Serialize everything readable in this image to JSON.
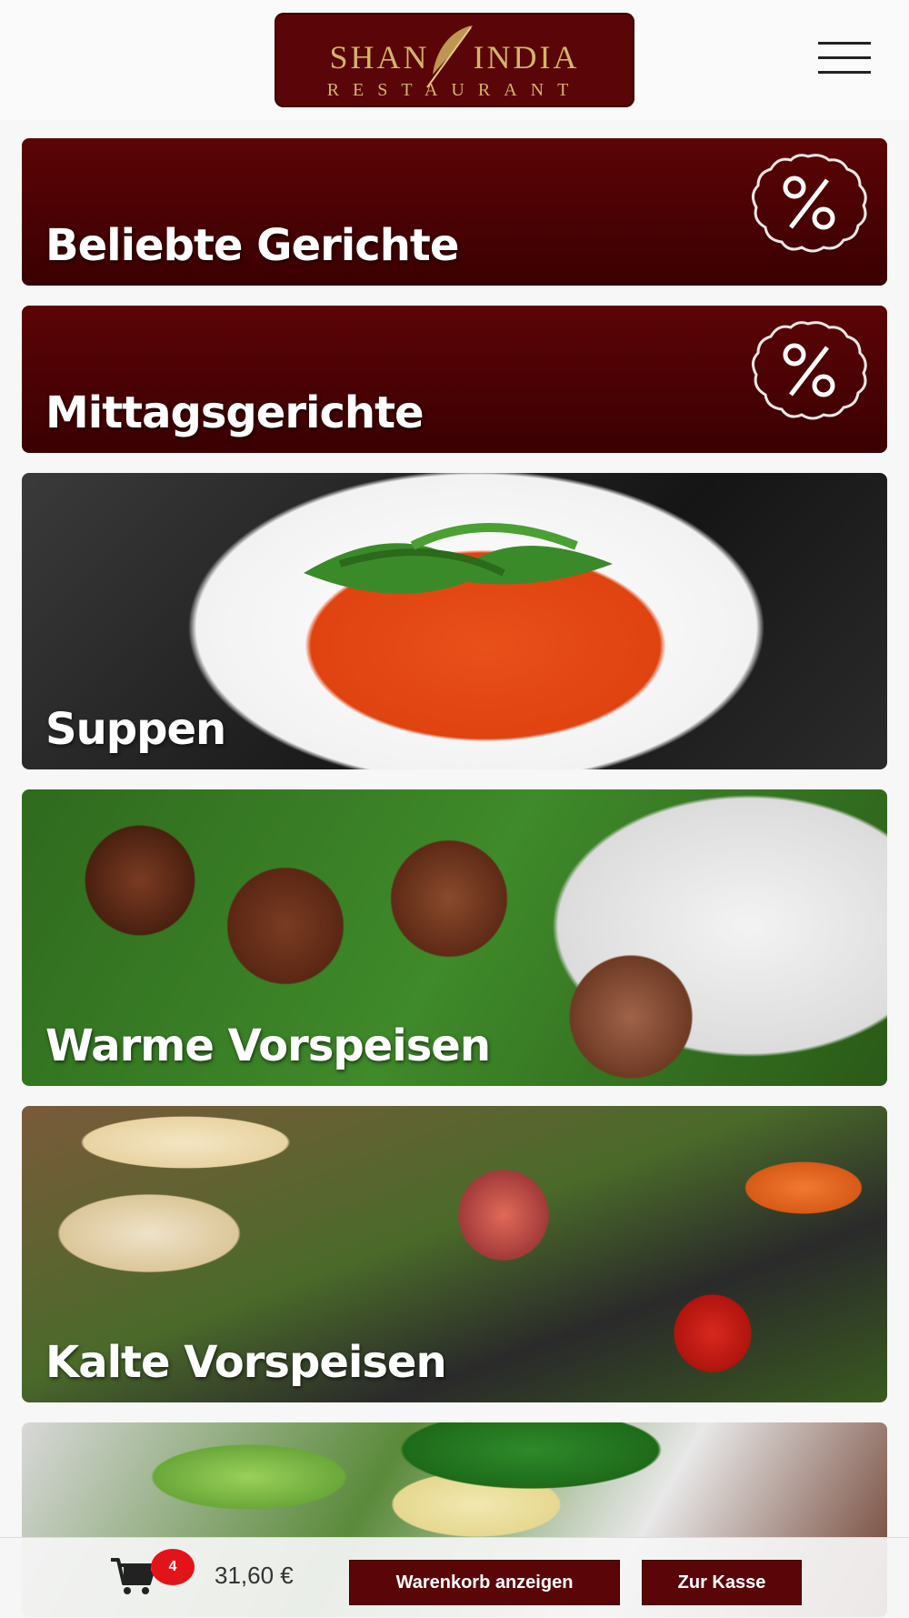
{
  "header": {
    "logo_top": "SHAN INDIA",
    "logo_top_left": "SHAN",
    "logo_top_right": "INDIA",
    "logo_bottom": "RESTAURANT",
    "menu_icon": "hamburger-menu-icon"
  },
  "categories": [
    {
      "label": "Beliebte Gerichte",
      "badge_icon": "percent-badge-icon"
    },
    {
      "label": "Mittagsgerichte",
      "badge_icon": "percent-badge-icon"
    },
    {
      "label": "Suppen",
      "image": "soup"
    },
    {
      "label": "Warme Vorspeisen",
      "image": "meatballs"
    },
    {
      "label": "Kalte Vorspeisen",
      "image": "fig-salad"
    },
    {
      "label": "",
      "image": "green-salad"
    }
  ],
  "cart": {
    "icon": "shopping-cart-icon",
    "count": "4",
    "total": "31,60 €",
    "view_cart_label": "Warenkorb anzeigen",
    "checkout_label": "Zur Kasse"
  },
  "colors": {
    "brand": "#5a0608",
    "logo_gold": "#d4b46a",
    "badge_red": "#e3131a"
  }
}
